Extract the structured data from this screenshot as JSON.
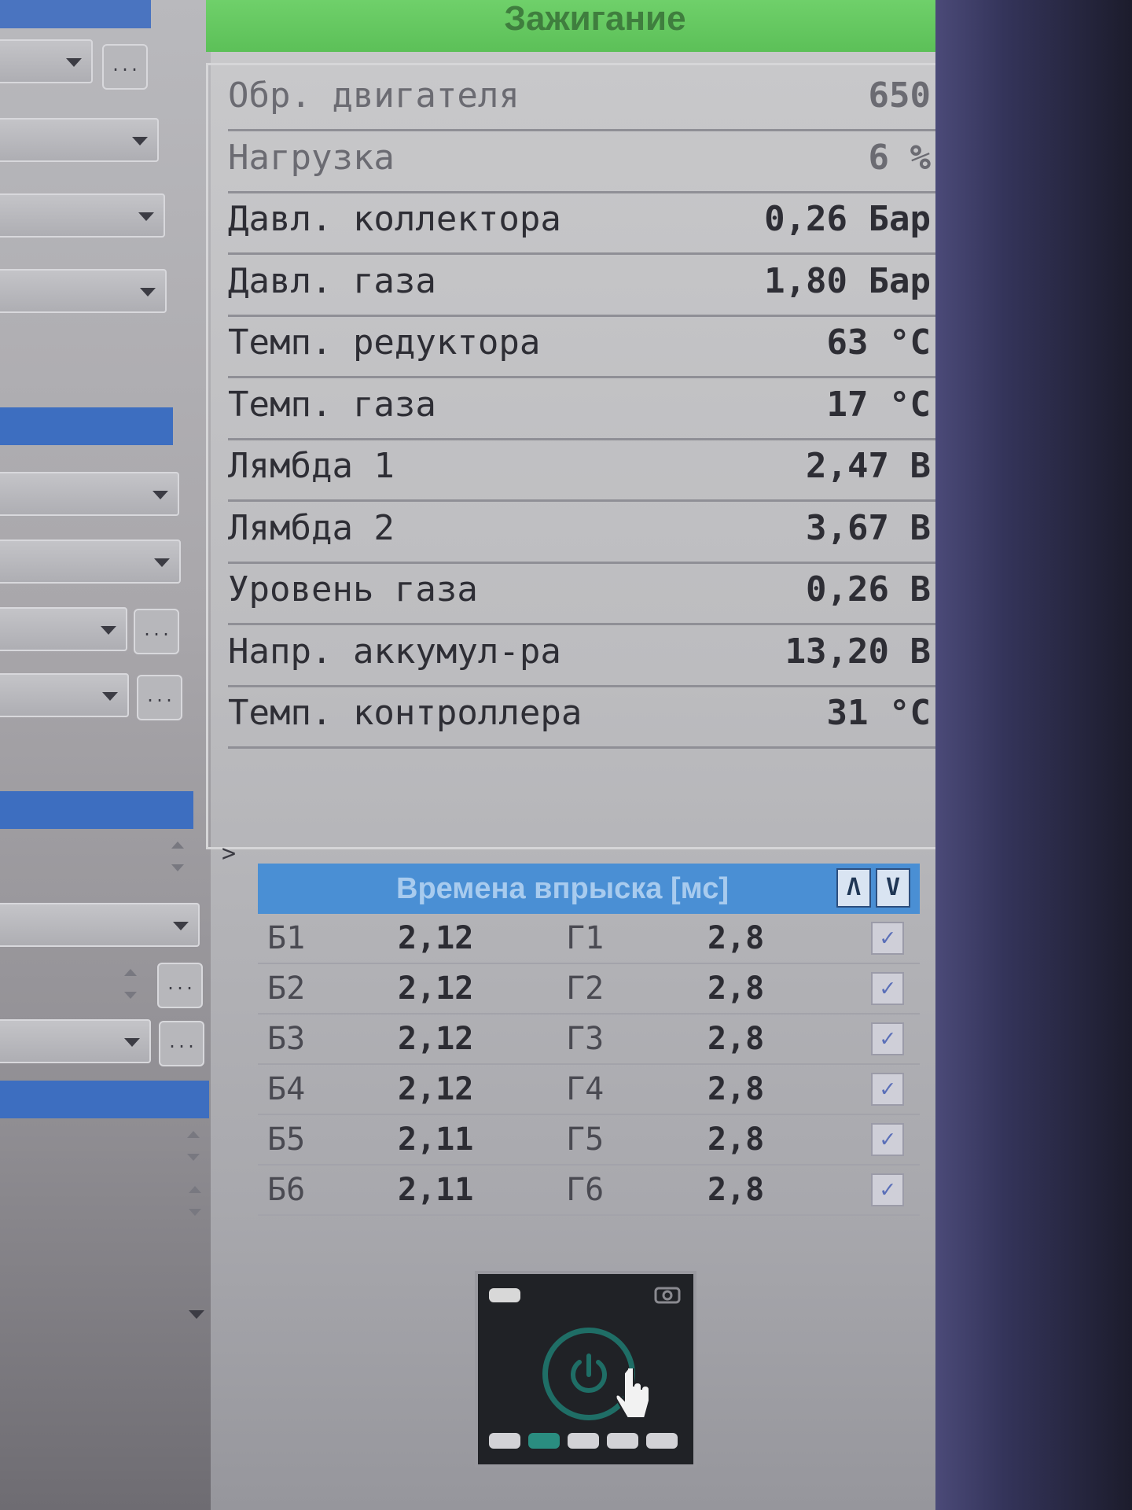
{
  "header": {
    "title": "Зажигание"
  },
  "sensors": [
    {
      "label": "Обр. двигателя",
      "value": "650"
    },
    {
      "label": "Нагрузка",
      "value": "6 %"
    },
    {
      "label": "Давл. коллектора",
      "value": "0,26 Бар"
    },
    {
      "label": "Давл. газа",
      "value": "1,80 Бар"
    },
    {
      "label": "Темп. редуктора",
      "value": "63 °C"
    },
    {
      "label": "Темп. газа",
      "value": "17 °C"
    },
    {
      "label": "Лямбда 1",
      "value": "2,47 В"
    },
    {
      "label": "Лямбда 2",
      "value": "3,67 В"
    },
    {
      "label": "Уровень газа",
      "value": "0,26 В"
    },
    {
      "label": "Напр. аккумул-ра",
      "value": "13,20 В"
    },
    {
      "label": "Темп. контроллера",
      "value": "31 °C"
    }
  ],
  "injection": {
    "title": "Времена впрыска [мс]",
    "up_label": "Λ",
    "down_label": "V",
    "rows": [
      {
        "b_label": "Б1",
        "b_value": "2,12",
        "g_label": "Г1",
        "g_value": "2,8",
        "checked": "✓"
      },
      {
        "b_label": "Б2",
        "b_value": "2,12",
        "g_label": "Г2",
        "g_value": "2,8",
        "checked": "✓"
      },
      {
        "b_label": "Б3",
        "b_value": "2,12",
        "g_label": "Г3",
        "g_value": "2,8",
        "checked": "✓"
      },
      {
        "b_label": "Б4",
        "b_value": "2,12",
        "g_label": "Г4",
        "g_value": "2,8",
        "checked": "✓"
      },
      {
        "b_label": "Б5",
        "b_value": "2,11",
        "g_label": "Г5",
        "g_value": "2,8",
        "checked": "✓"
      },
      {
        "b_label": "Б6",
        "b_value": "2,11",
        "g_label": "Г6",
        "g_value": "2,8",
        "checked": "✓"
      }
    ]
  },
  "misc": {
    "expand_marker": ">",
    "ellipsis": "..."
  },
  "colors": {
    "header_green": "#6fd06a",
    "inj_header_blue": "#4a8fd4",
    "widget_accent": "#1f6e66"
  },
  "icons": [
    "chevron-down-icon",
    "checkbox-icon",
    "power-icon",
    "hand-pointer-icon",
    "camera-icon"
  ]
}
